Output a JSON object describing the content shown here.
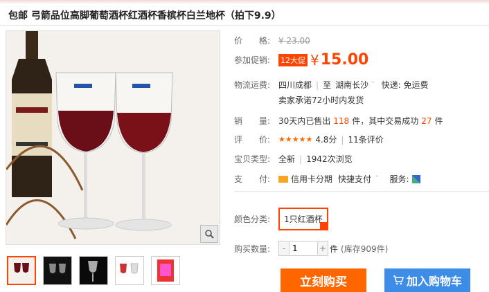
{
  "title": "包邮 弓箭品位高脚葡萄酒杯红酒杯香槟杯白兰地杯（拍下9.9）",
  "price_row": {
    "label": "价　　格:",
    "original": "¥ 23.00"
  },
  "promo_row": {
    "label": "参加促销:",
    "badge": "12大促",
    "yen": "¥",
    "price": "15.00"
  },
  "shipping_row": {
    "label": "物流运费:",
    "from": "四川成都",
    "to_prefix": "至",
    "to": "湖南长沙",
    "fee": "快递: 免运费",
    "promise": "卖家承诺72小时内发货"
  },
  "sales_row": {
    "label": "销　　量:",
    "prefix": "30天内已售出",
    "sold": "118",
    "middle": "件，其中交易成功",
    "success": "27",
    "suffix": "件"
  },
  "rating_row": {
    "label": "评　　价:",
    "stars": "★★★★★",
    "score": "4.8分",
    "reviews": "11条评价"
  },
  "type_row": {
    "label": "宝贝类型:",
    "condition": "全新",
    "views": "1942次浏览"
  },
  "pay_row": {
    "label": "支　　付:",
    "card": "信用卡分期",
    "quick": "快捷支付",
    "service_label": "服务:"
  },
  "color_row": {
    "label": "颜色分类:",
    "option": "1只红酒杯"
  },
  "qty_row": {
    "label": "购买数量:",
    "minus": "-",
    "value": "1",
    "plus": "+",
    "unit": "件",
    "stock": "(库存909件)"
  },
  "buttons": {
    "buy": "立刻购买",
    "cart": "加入购物车"
  },
  "colors": {
    "accent": "#ff4400",
    "buy": "#ff6600",
    "cart": "#3d8ce8"
  }
}
